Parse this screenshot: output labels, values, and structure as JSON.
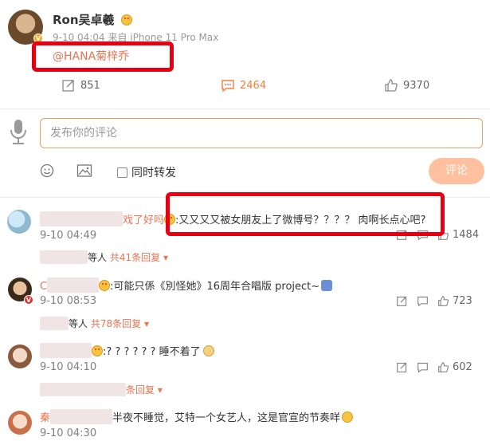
{
  "post": {
    "author": "Ron吴卓羲",
    "meta": "9-10 04:04  来自 iPhone 11 Pro Max",
    "text": "@HANA菊梓乔",
    "repost_count": "851",
    "comment_count": "2464",
    "like_count": "9370"
  },
  "composer": {
    "placeholder": "发布你的评论",
    "repost_label": "同时转发",
    "submit_label": "评论"
  },
  "comments": [
    {
      "name_partial": "戏了好吗",
      "text": ":又又又又被女朋友上了微博号？？？？ 肉啊长点心吧?",
      "time": "9-10 04:49",
      "like_count": "1484",
      "reply_suffix": "等人",
      "reply_count_label": "共41条回复"
    },
    {
      "name_partial": "C",
      "text": ":可能只係《別怪她》16周年合唱版 project~",
      "time": "9-10 08:53",
      "like_count": "723",
      "reply_suffix": "等人",
      "reply_count_label": "共78条回复"
    },
    {
      "name_partial": "",
      "text": ":? ? ? ? ? ?  睡不着了",
      "time": "9-10 04:10",
      "like_count": "602",
      "reply_suffix": "",
      "reply_count_label": "条回复"
    },
    {
      "name_partial": "秦",
      "text": "半夜不睡觉，艾特一个女艺人，这是官宣的节奏咩",
      "time": "9-10 04:30",
      "like_count": "",
      "reply_suffix": "",
      "reply_count_label": ""
    }
  ],
  "colors": {
    "accent": "#eb7350",
    "highlight_box": "#e60012",
    "submit_bg": "#ffc09f"
  }
}
